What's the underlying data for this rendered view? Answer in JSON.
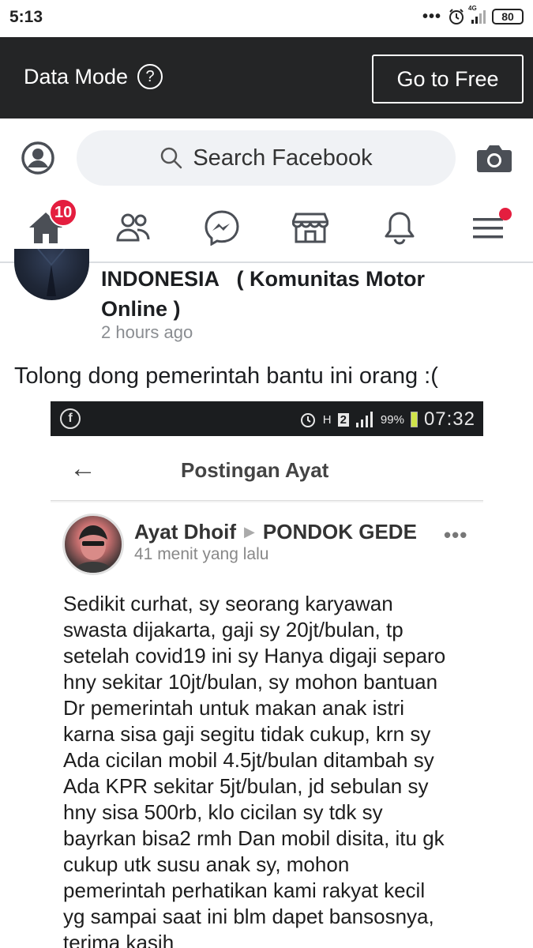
{
  "status_bar": {
    "time": "5:13",
    "network_label": "4G",
    "battery": "80"
  },
  "data_mode_bar": {
    "label": "Data Mode",
    "help_icon": "?",
    "go_free_label": "Go to Free"
  },
  "search_bar": {
    "placeholder": "Search Facebook"
  },
  "nav": {
    "home_badge": "10",
    "items": [
      "home",
      "friends",
      "messenger",
      "marketplace",
      "notifications",
      "menu"
    ]
  },
  "post": {
    "group_name_line1": "INDONESIA   ( Komunitas Motor",
    "group_name_line2": "Online )",
    "time": "2 hours ago",
    "text": "Tolong dong pemerintah bantu ini orang :("
  },
  "embedded_screenshot": {
    "status_time": "07:32",
    "status_battery": "99%",
    "status_h": "H",
    "status_sim": "2",
    "header_title": "Postingan Ayat",
    "author": "Ayat Dhoif",
    "location": "PONDOK GEDE",
    "ago": "41 menit yang lalu",
    "more": "•••",
    "body_lines": [
      "Sedikit curhat, sy seorang karyawan",
      "swasta dijakarta, gaji sy 20jt/bulan, tp",
      "setelah covid19 ini sy Hanya digaji separo",
      "hny sekitar 10jt/bulan, sy mohon bantuan",
      "Dr pemerintah untuk makan anak istri",
      "karna sisa gaji segitu tidak cukup, krn sy",
      "Ada cicilan mobil 4.5jt/bulan ditambah sy",
      "Ada KPR sekitar 5jt/bulan, jd sebulan sy",
      "hny sisa 500rb, klo cicilan sy tdk sy",
      "bayrkan bisa2 rmh Dan mobil disita, itu gk",
      "cukup utk susu anak sy, mohon",
      "pemerintah perhatikan kami rakyat kecil",
      "yg sampai saat ini blm dapet bansosnya,",
      "terima kasih"
    ]
  },
  "colors": {
    "data_bar_bg": "#242526",
    "search_bg": "#f0f2f5",
    "badge_red": "#e41e3f",
    "icon_gray": "#4b4f56"
  }
}
